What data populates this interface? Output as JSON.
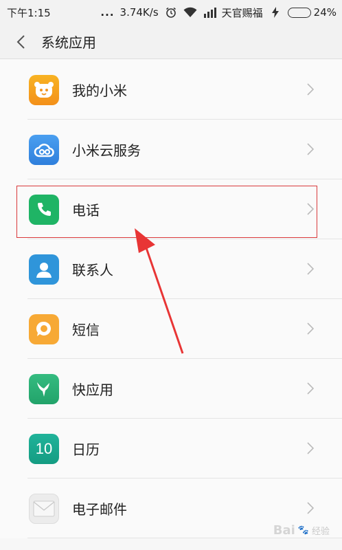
{
  "status_bar": {
    "time": "下午1:15",
    "dots": "...",
    "speed": "3.74K/s",
    "carrier": "天官赐福",
    "battery": "24%",
    "battery_level": 0.24
  },
  "header": {
    "title": "系统应用",
    "back_icon": "chevron-left-icon"
  },
  "apps": [
    {
      "label": "我的小米",
      "icon": "mi-bear-icon",
      "color": "#f59e1b"
    },
    {
      "label": "小米云服务",
      "icon": "cloud-icon",
      "color": "#3a8ce6"
    },
    {
      "label": "电话",
      "icon": "phone-icon",
      "color": "#1fb465"
    },
    {
      "label": "联系人",
      "icon": "contact-icon",
      "color": "#2f95da"
    },
    {
      "label": "短信",
      "icon": "message-icon",
      "color": "#f7a935"
    },
    {
      "label": "快应用",
      "icon": "bird-icon",
      "color": "#2fb37a"
    },
    {
      "label": "日历",
      "icon": "calendar-icon",
      "calendar_day": "10",
      "color": "#1aa98e"
    },
    {
      "label": "电子邮件",
      "icon": "mail-icon",
      "color": "#e8e8e8"
    }
  ],
  "watermark": {
    "logo": "Bai",
    "text": "经验"
  }
}
